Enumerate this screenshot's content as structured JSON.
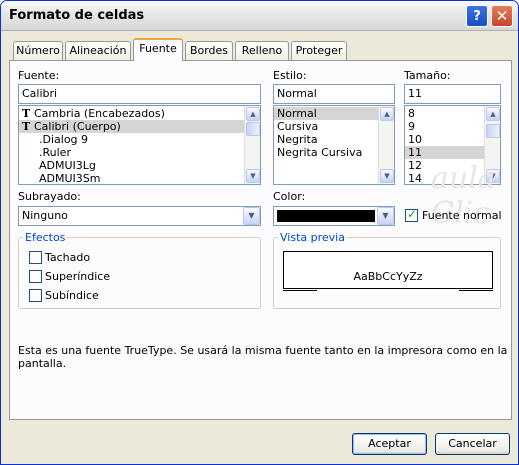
{
  "window": {
    "title": "Formato de celdas",
    "help": "?",
    "close": "✕"
  },
  "tabs": [
    {
      "label": "Número"
    },
    {
      "label": "Alineación"
    },
    {
      "label": "Fuente"
    },
    {
      "label": "Bordes"
    },
    {
      "label": "Relleno"
    },
    {
      "label": "Proteger"
    }
  ],
  "font": {
    "label": "Fuente:",
    "value": "Calibri",
    "items": [
      {
        "label": "Cambria (Encabezados)",
        "icon": "truetype-icon"
      },
      {
        "label": "Calibri (Cuerpo)",
        "icon": "truetype-icon",
        "selected": true
      },
      {
        "label": ".Dialog 9"
      },
      {
        "label": ".Ruler"
      },
      {
        "label": "ADMUI3Lg"
      },
      {
        "label": "ADMUI3Sm"
      }
    ]
  },
  "style": {
    "label": "Estilo:",
    "value": "Normal",
    "items": [
      {
        "label": "Normal",
        "selected": true
      },
      {
        "label": "Cursiva"
      },
      {
        "label": "Negrita"
      },
      {
        "label": "Negrita Cursiva"
      }
    ]
  },
  "size": {
    "label": "Tamaño:",
    "value": "11",
    "items": [
      {
        "label": "8"
      },
      {
        "label": "9"
      },
      {
        "label": "10"
      },
      {
        "label": "11",
        "selected": true
      },
      {
        "label": "12"
      },
      {
        "label": "14"
      }
    ]
  },
  "underline": {
    "label": "Subrayado:",
    "value": "Ninguno"
  },
  "color": {
    "label": "Color:",
    "value_color": "#000000"
  },
  "normal_font": {
    "label": "Fuente normal",
    "checked": true
  },
  "effects": {
    "title": "Efectos",
    "items": [
      {
        "label": "Tachado",
        "checked": false
      },
      {
        "label": "Superíndice",
        "checked": false
      },
      {
        "label": "Subíndice",
        "checked": false
      }
    ]
  },
  "preview": {
    "title": "Vista previa",
    "sample": "AaBbCcYyZz"
  },
  "info": "Esta es una fuente TrueType. Se usará la misma fuente tanto en la impresora como en la pantalla.",
  "buttons": {
    "ok": "Aceptar",
    "cancel": "Cancelar"
  },
  "watermark": "aula Clic",
  "colors": {
    "title_gradient_top": "#fbfbfb",
    "panel": "#fcfcfe",
    "group_title": "#0046d5",
    "tab_highlight": "#f1a838"
  }
}
